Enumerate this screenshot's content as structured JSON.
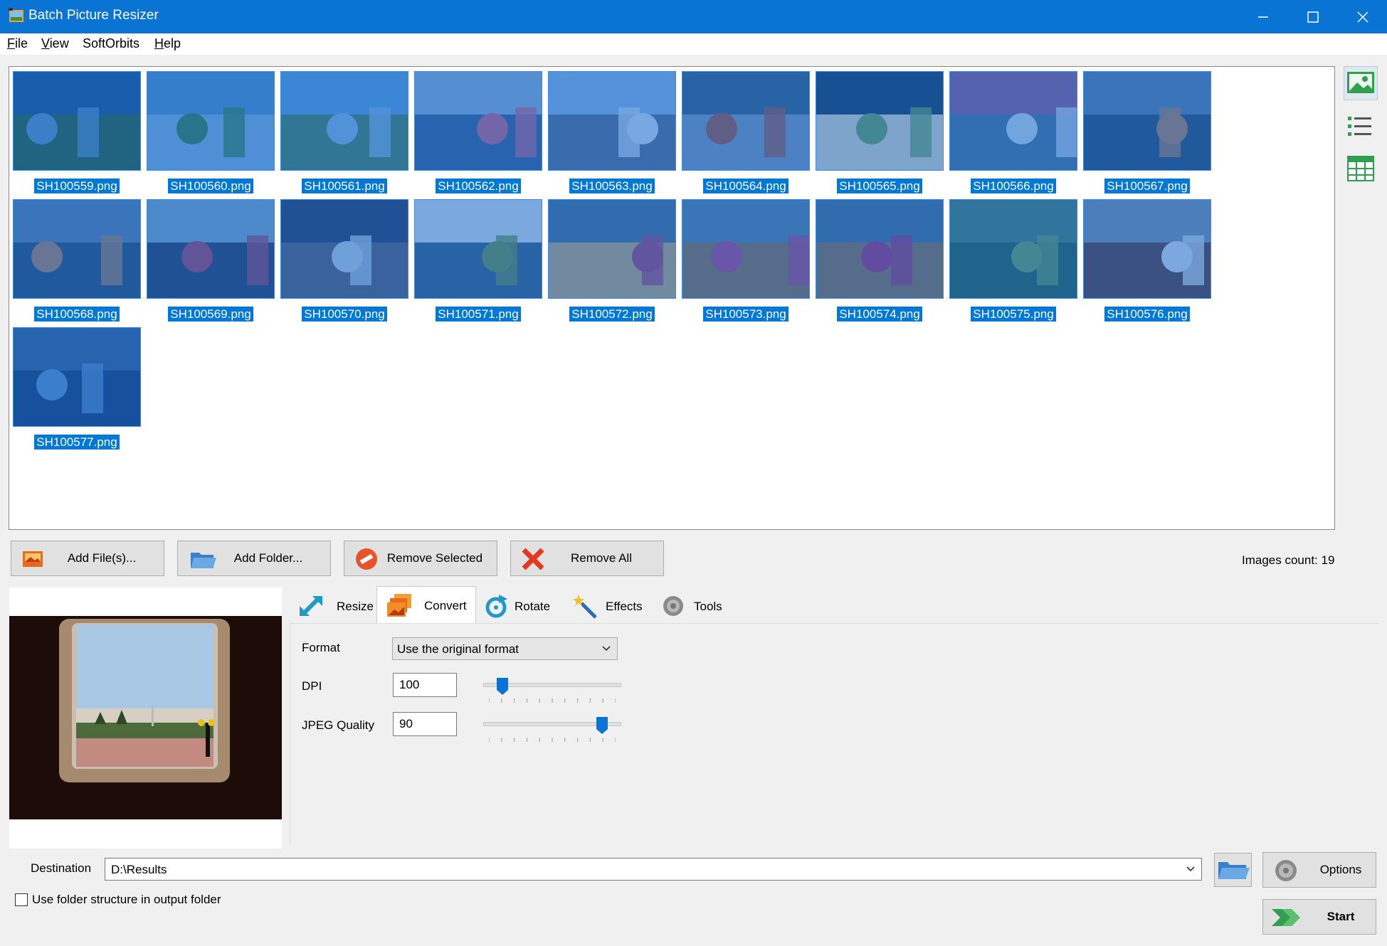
{
  "window": {
    "title": "Batch Picture Resizer",
    "icon": "app-icon",
    "controls": [
      "minimize-icon",
      "maximize-icon",
      "close-icon"
    ]
  },
  "menu": {
    "items": [
      {
        "label": "File",
        "accel": "F",
        "rest": "ile"
      },
      {
        "label": "View",
        "accel": "V",
        "rest": "iew"
      },
      {
        "label": "SoftOrbits",
        "accel": "",
        "rest": "SoftOrbits"
      },
      {
        "label": "Help",
        "accel": "H",
        "rest": "elp"
      }
    ]
  },
  "images": [
    {
      "name": "SH100559.png"
    },
    {
      "name": "SH100560.png"
    },
    {
      "name": "SH100561.png"
    },
    {
      "name": "SH100562.png"
    },
    {
      "name": "SH100563.png"
    },
    {
      "name": "SH100564.png"
    },
    {
      "name": "SH100565.png"
    },
    {
      "name": "SH100566.png"
    },
    {
      "name": "SH100567.png"
    },
    {
      "name": "SH100568.png"
    },
    {
      "name": "SH100569.png"
    },
    {
      "name": "SH100570.png"
    },
    {
      "name": "SH100571.png"
    },
    {
      "name": "SH100572.png"
    },
    {
      "name": "SH100573.png"
    },
    {
      "name": "SH100574.png"
    },
    {
      "name": "SH100575.png"
    },
    {
      "name": "SH100576.png"
    },
    {
      "name": "SH100577.png"
    }
  ],
  "view_modes": [
    "thumbnails-view-icon",
    "list-view-icon",
    "table-view-icon"
  ],
  "actions": {
    "add_files": "Add File(s)...",
    "add_folder": "Add Folder...",
    "remove_selected": "Remove Selected",
    "remove_all": "Remove All"
  },
  "images_count": "Images count: 19",
  "tabs": [
    {
      "label": "Resize",
      "icon": "resize-arrow-icon"
    },
    {
      "label": "Convert",
      "icon": "convert-images-icon",
      "active": true
    },
    {
      "label": "Rotate",
      "icon": "rotate-icon"
    },
    {
      "label": "Effects",
      "icon": "magic-wand-icon"
    },
    {
      "label": "Tools",
      "icon": "gear-icon"
    }
  ],
  "convert": {
    "format_label": "Format",
    "format_value": "Use the original format",
    "dpi_label": "DPI",
    "dpi_value": "100",
    "dpi_slider_fraction": 0.1,
    "jpeg_label": "JPEG Quality",
    "jpeg_value": "90",
    "jpeg_slider_fraction": 0.9
  },
  "destination": {
    "label": "Destination",
    "value": "D:\\Results"
  },
  "use_folder_structure": {
    "label": "Use folder structure in output folder",
    "checked": false
  },
  "options_label": "Options",
  "start_label": "Start",
  "colors": {
    "titlebar": "#0a74d4",
    "selection": "#0078d7",
    "slider_thumb": "#0a74d4"
  }
}
